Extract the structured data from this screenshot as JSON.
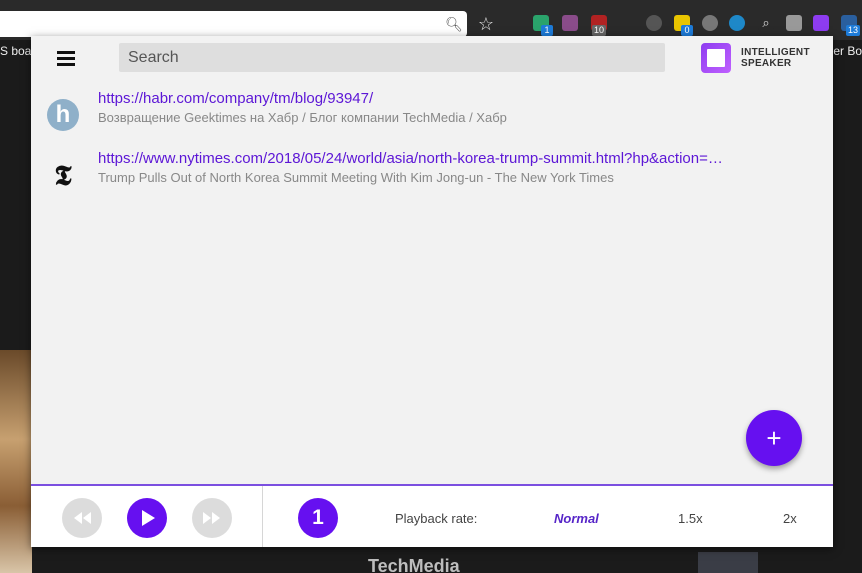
{
  "browser": {
    "bookmark_left": "S boa",
    "bookmark_right": "er Bo",
    "ext_badges": [
      "1",
      "10",
      "0",
      "13"
    ]
  },
  "background_page": {
    "title": "TechMedia"
  },
  "popup": {
    "search_placeholder": "Search",
    "logo_line1": "INTELLIGENT",
    "logo_line2": "SPEAKER",
    "items": [
      {
        "favicon": "h",
        "url": "https://habr.com/company/tm/blog/93947/",
        "title": "Возвращение Geektimes на Хабр / Блог компании TechMedia / Хабр"
      },
      {
        "favicon": "𝕿",
        "url": "https://www.nytimes.com/2018/05/24/world/asia/north-korea-trump-summit.html?hp&action=…",
        "title": "Trump Pulls Out of North Korea Summit Meeting With Kim Jong-un - The New York Times"
      }
    ],
    "fab_label": "+",
    "player": {
      "count": "1",
      "rate_label": "Playback rate:",
      "rates": [
        "Normal",
        "1.5x",
        "2x"
      ],
      "active_rate": "Normal"
    }
  },
  "colors": {
    "accent": "#6610f0",
    "link": "#5c16d6"
  }
}
